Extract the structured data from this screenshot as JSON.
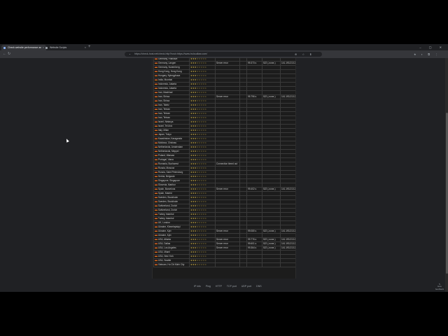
{
  "browser": {
    "tabs": [
      {
        "label": "Check website performance an",
        "active": true
      },
      {
        "label": "Website Scripts",
        "active": false
      }
    ],
    "new_tab": "+",
    "window_controls": "– ▢ ✕",
    "url": "https://check-host.net/check-http?host=https://www.truloudlaw.com/",
    "back": "←",
    "forward": "→",
    "reload": "↻",
    "lock": "🔒",
    "right_icons": "★ ◐ ⧉ ⋮",
    "omnibox_icons": "⊕ ☆ ⬇"
  },
  "table": {
    "rows": [
      {
        "location": "Germany, Frankfurt",
        "stars": "★★★☆☆☆☆☆",
        "result": "",
        "time": "",
        "code": "",
        "ip": ""
      },
      {
        "location": "Germany, Langen",
        "stars": "★★★☆☆☆☆☆",
        "result": "Server error",
        "time": "99.373 s",
        "code": "522 (-none-)",
        "ip": "141.193.213.21"
      },
      {
        "location": "Germany, Nuremberg",
        "stars": "★★★☆☆☆☆☆",
        "result": "",
        "time": "",
        "code": "",
        "ip": ""
      },
      {
        "location": "Hong Kong, Hong Kong",
        "stars": "★★★☆☆☆☆☆",
        "result": "",
        "time": "",
        "code": "",
        "ip": ""
      },
      {
        "location": "Hungary, Nyiregyhaza",
        "stars": "★★★☆☆☆☆☆",
        "result": "",
        "time": "",
        "code": "",
        "ip": ""
      },
      {
        "location": "India, Mumbai",
        "stars": "★★★☆☆☆☆☆",
        "result": "",
        "time": "",
        "code": "",
        "ip": ""
      },
      {
        "location": "Indonesia, Jakarta",
        "stars": "★★★☆☆☆☆☆",
        "result": "",
        "time": "",
        "code": "",
        "ip": ""
      },
      {
        "location": "Indonesia, Jakarta",
        "stars": "★★★☆☆☆☆☆",
        "result": "",
        "time": "",
        "code": "",
        "ip": ""
      },
      {
        "location": "Iran, Mashhad",
        "stars": "★★★☆☆☆☆☆",
        "result": "",
        "time": "",
        "code": "",
        "ip": ""
      },
      {
        "location": "Iran, Shiraz",
        "stars": "★★★☆☆☆☆☆",
        "result": "Server error",
        "time": "95.796 s",
        "code": "522 (-none-)",
        "ip": "141.193.213.21"
      },
      {
        "location": "Iran, Shiraz",
        "stars": "★★★☆☆☆☆☆",
        "result": "",
        "time": "",
        "code": "",
        "ip": ""
      },
      {
        "location": "Iran, Tabriz",
        "stars": "★★★☆☆☆☆☆",
        "result": "",
        "time": "",
        "code": "",
        "ip": ""
      },
      {
        "location": "Iran, Tehran",
        "stars": "★★★☆☆☆☆☆",
        "result": "",
        "time": "",
        "code": "",
        "ip": ""
      },
      {
        "location": "Iran, Tehran",
        "stars": "★★★☆☆☆☆☆",
        "result": "",
        "time": "",
        "code": "",
        "ip": ""
      },
      {
        "location": "Iran, Tehran",
        "stars": "★★★☆☆☆☆☆",
        "result": "",
        "time": "",
        "code": "",
        "ip": ""
      },
      {
        "location": "Israel, Netanya",
        "stars": "★★★☆☆☆☆☆",
        "result": "",
        "time": "",
        "code": "",
        "ip": ""
      },
      {
        "location": "Israel, Tel Aviv",
        "stars": "★★★☆☆☆☆☆",
        "result": "",
        "time": "",
        "code": "",
        "ip": ""
      },
      {
        "location": "Italy, Milan",
        "stars": "★★★☆☆☆☆☆",
        "result": "",
        "time": "",
        "code": "",
        "ip": ""
      },
      {
        "location": "Japan, Tokyo",
        "stars": "★★★☆☆☆☆☆",
        "result": "",
        "time": "",
        "code": "",
        "ip": ""
      },
      {
        "location": "Kazakhstan, Karaganda",
        "stars": "★★★☆☆☆☆☆",
        "result": "",
        "time": "",
        "code": "",
        "ip": ""
      },
      {
        "location": "Moldova, Chisinau",
        "stars": "★★★☆☆☆☆☆",
        "result": "",
        "time": "",
        "code": "",
        "ip": ""
      },
      {
        "location": "Netherlands, Amsterdam",
        "stars": "★★★☆☆☆☆☆",
        "result": "",
        "time": "",
        "code": "",
        "ip": ""
      },
      {
        "location": "Netherlands, Meppel",
        "stars": "★★★☆☆☆☆☆",
        "result": "",
        "time": "",
        "code": "",
        "ip": ""
      },
      {
        "location": "Poland, Warsaw",
        "stars": "★★★☆☆☆☆☆",
        "result": "",
        "time": "",
        "code": "",
        "ip": ""
      },
      {
        "location": "Portugal, Viana",
        "stars": "★★★☆☆☆☆☆",
        "result": "",
        "time": "",
        "code": "",
        "ip": ""
      },
      {
        "location": "Romania, Bucharest",
        "stars": "★★★☆☆☆☆☆",
        "result": "Connection timed out",
        "time": "",
        "code": "",
        "ip": ""
      },
      {
        "location": "Russia, Moscow",
        "stars": "★★★☆☆☆☆☆",
        "result": "",
        "time": "",
        "code": "",
        "ip": ""
      },
      {
        "location": "Russia, Saint Petersburg",
        "stars": "★★★☆☆☆☆☆",
        "result": "",
        "time": "",
        "code": "",
        "ip": ""
      },
      {
        "location": "Serbia, Belgrade",
        "stars": "★★★☆☆☆☆☆",
        "result": "",
        "time": "",
        "code": "",
        "ip": ""
      },
      {
        "location": "Singapore, Singapore",
        "stars": "★★★☆☆☆☆☆",
        "result": "",
        "time": "",
        "code": "",
        "ip": ""
      },
      {
        "location": "Slovenia, Maribor",
        "stars": "★★★☆☆☆☆☆",
        "result": "",
        "time": "",
        "code": "",
        "ip": ""
      },
      {
        "location": "Spain, Barcelona",
        "stars": "★★★☆☆☆☆☆",
        "result": "Server error",
        "time": "99.402 s",
        "code": "522 (-none-)",
        "ip": "141.193.213.20"
      },
      {
        "location": "Spain, Madrid",
        "stars": "★★★☆☆☆☆☆",
        "result": "",
        "time": "",
        "code": "",
        "ip": ""
      },
      {
        "location": "Sweden, Stockholm",
        "stars": "★★★☆☆☆☆☆",
        "result": "",
        "time": "",
        "code": "",
        "ip": ""
      },
      {
        "location": "Sweden, Stockholm",
        "stars": "★★★☆☆☆☆☆",
        "result": "",
        "time": "",
        "code": "",
        "ip": ""
      },
      {
        "location": "Switzerland, Zurich",
        "stars": "★★★☆☆☆☆☆",
        "result": "",
        "time": "",
        "code": "",
        "ip": ""
      },
      {
        "location": "Switzerland, Zurich",
        "stars": "★★★☆☆☆☆☆",
        "result": "",
        "time": "",
        "code": "",
        "ip": ""
      },
      {
        "location": "Turkey, Istanbul",
        "stars": "★★★☆☆☆☆☆",
        "result": "",
        "time": "",
        "code": "",
        "ip": ""
      },
      {
        "location": "Turkey, Istanbul",
        "stars": "★★★☆☆☆☆☆",
        "result": "",
        "time": "",
        "code": "",
        "ip": ""
      },
      {
        "location": "UK, London",
        "stars": "★★★☆☆☆☆☆",
        "result": "",
        "time": "",
        "code": "",
        "ip": ""
      },
      {
        "location": "Ukraine, Khmelnytskyi",
        "stars": "★★★☆☆☆☆☆",
        "result": "",
        "time": "",
        "code": "",
        "ip": ""
      },
      {
        "location": "Ukraine, Kyiv",
        "stars": "★★★☆☆☆☆☆",
        "result": "Server error",
        "time": "99.080 s",
        "code": "522 (-none-)",
        "ip": "141.193.213.21"
      },
      {
        "location": "Ukraine, Kyiv",
        "stars": "★★★☆☆☆☆☆",
        "result": "",
        "time": "",
        "code": "",
        "ip": ""
      },
      {
        "location": "USA, Atlanta",
        "stars": "★★★☆☆☆☆☆",
        "result": "Server error",
        "time": "99.776 s",
        "code": "522 (-none-)",
        "ip": "141.193.213.21"
      },
      {
        "location": "USA, Dallas",
        "stars": "★★★☆☆☆☆☆",
        "result": "Server error",
        "time": "99.601 s",
        "code": "522 (-none-)",
        "ip": "141.193.213.21"
      },
      {
        "location": "USA, Los Angeles",
        "stars": "★★★☆☆☆☆☆",
        "result": "Server error",
        "time": "99.364 s",
        "code": "522 (-none-)",
        "ip": "141.193.213.20"
      },
      {
        "location": "USA, Miami",
        "stars": "★★★☆☆☆☆☆",
        "result": "",
        "time": "",
        "code": "",
        "ip": ""
      },
      {
        "location": "USA, New York",
        "stars": "★★★☆☆☆☆☆",
        "result": "",
        "time": "",
        "code": "",
        "ip": ""
      },
      {
        "location": "USA, Seattle",
        "stars": "★★★☆☆☆☆☆",
        "result": "",
        "time": "",
        "code": "",
        "ip": ""
      },
      {
        "location": "Vietnam, Ho Chi Minh City",
        "stars": "★★★☆☆☆☆☆",
        "result": "",
        "time": "",
        "code": "",
        "ip": ""
      }
    ]
  },
  "footer": {
    "links": [
      "IP info",
      "Ping",
      "HTTP",
      "TCP port",
      "UDP port",
      "DNS"
    ]
  },
  "help_button": {
    "icon": "✎",
    "label": "Give feedback"
  }
}
